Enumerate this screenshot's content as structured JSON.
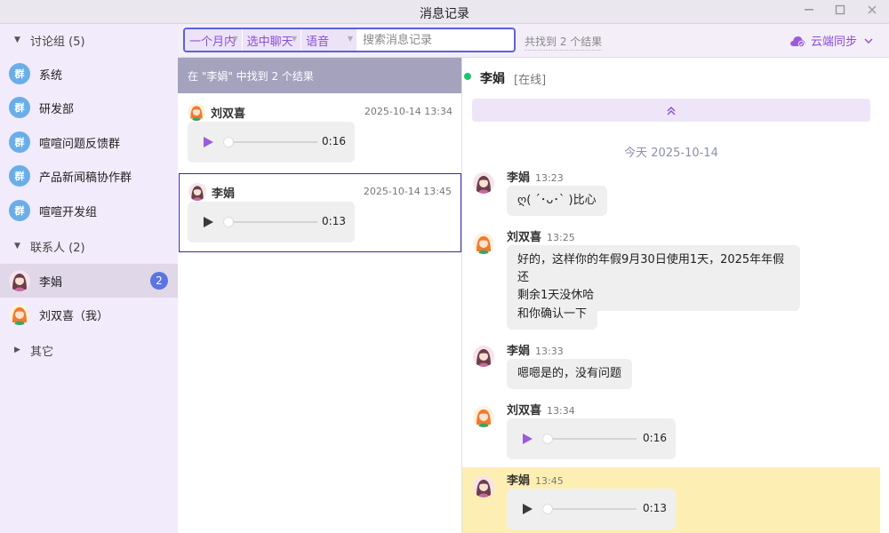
{
  "window": {
    "title": "消息记录"
  },
  "sidebar": {
    "groups_header": "讨论组 (5)",
    "groups": [
      {
        "icon": "群",
        "label": "系统"
      },
      {
        "icon": "群",
        "label": "研发部"
      },
      {
        "icon": "群",
        "label": "喧喧问题反馈群"
      },
      {
        "icon": "群",
        "label": "产品新闻稿协作群"
      },
      {
        "icon": "群",
        "label": "喧喧开发组"
      }
    ],
    "contacts_header": "联系人 (2)",
    "contacts": [
      {
        "label": "李娟",
        "badge": "2"
      },
      {
        "label": "刘双喜（我）"
      }
    ],
    "others_header": "其它"
  },
  "toolbar": {
    "range_select": "一个月内",
    "chat_select": "选中聊天",
    "type_select": "语音",
    "search_placeholder": "搜索消息记录",
    "found_text": "共找到 2 个结果",
    "sync_label": "云端同步"
  },
  "results": {
    "header": "在 \"李娟\" 中找到 2 个结果",
    "items": [
      {
        "sender": "刘双喜",
        "time": "2025-10-14 13:34",
        "duration": "0:16"
      },
      {
        "sender": "李娟",
        "time": "2025-10-14 13:45",
        "duration": "0:13"
      }
    ]
  },
  "chat": {
    "name": "李娟",
    "status": "[在线]",
    "date_separator": "今天 2025-10-14",
    "messages": [
      {
        "sender": "李娟",
        "time": "13:23",
        "text": "ღ( ´･ᴗ･` )比心"
      },
      {
        "sender": "刘双喜",
        "time": "13:25",
        "text_line1": "好的，这样你的年假9月30日使用1天，2025年年假还",
        "text_line2": "剩余1天没休哈"
      },
      {
        "text": "和你确认一下"
      },
      {
        "sender": "李娟",
        "time": "13:33",
        "text": "嗯嗯是的，没有问题"
      },
      {
        "sender": "刘双喜",
        "time": "13:34",
        "duration": "0:16"
      },
      {
        "sender": "李娟",
        "time": "13:45",
        "duration": "0:13"
      }
    ]
  },
  "colors": {
    "accent": "#8a4fd6",
    "badge": "#5b74e0",
    "online": "#1ec26e",
    "highlight": "#fdeeb4",
    "group_avatar": "#6aaee9"
  }
}
